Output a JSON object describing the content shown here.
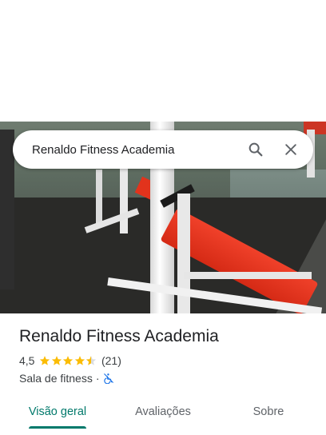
{
  "search": {
    "query": "Renaldo Fitness Academia",
    "search_icon": "search-icon",
    "close_icon": "close-icon"
  },
  "photo": {
    "subject": "gym-photo"
  },
  "place": {
    "title": "Renaldo Fitness Academia",
    "rating": "4,5",
    "rating_value": 4.5,
    "rating_max": 5,
    "reviews": "(21)",
    "category": "Sala de fitness",
    "separator": "·",
    "accessibility_icon": "not-accessible-icon"
  },
  "tabs": [
    {
      "label": "Visão geral",
      "active": true
    },
    {
      "label": "Avaliações",
      "active": false
    },
    {
      "label": "Sobre",
      "active": false
    }
  ],
  "colors": {
    "accent": "#00796b",
    "star": "#fbbc04",
    "star_empty": "#dadce0",
    "access_icon": "#1a73e8"
  }
}
